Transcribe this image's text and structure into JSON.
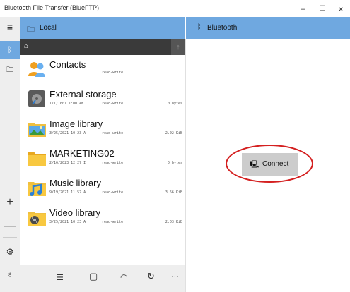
{
  "window": {
    "title": "Bluetooth File Transfer (BlueFTP)",
    "minimize_glyph": "–",
    "maximize_glyph": "☐",
    "close_glyph": "×"
  },
  "sidebar": {
    "menu_glyph": "≡",
    "bluetooth_glyph": "ᛒ",
    "local_glyph": "🗀",
    "plus_glyph": "+",
    "minus_glyph": "—",
    "settings_glyph": "⚙",
    "tips_glyph": "♁"
  },
  "left_pane": {
    "title": "Local",
    "icon_glyph": "🗀",
    "home_glyph": "⌂",
    "up_glyph": "↑",
    "items": [
      {
        "name": "Contacts",
        "date": "",
        "permission": "read-write",
        "size": "",
        "icon": "contacts-icon"
      },
      {
        "name": "External storage",
        "date": "1/1/1601 1:00 AM",
        "permission": "read-write",
        "size": "0 bytes",
        "icon": "external-storage-icon"
      },
      {
        "name": "Image library",
        "date": "3/25/2021 10:23 A",
        "permission": "read-write",
        "size": "2.02 KiB",
        "icon": "image-library-icon"
      },
      {
        "name": "MARKETING02",
        "date": "2/16/2023 12:27 I",
        "permission": "read-write",
        "size": "0 bytes",
        "icon": "folder-icon"
      },
      {
        "name": "Music library",
        "date": "9/19/2021 11:57 A",
        "permission": "read-write",
        "size": "3.56 KiB",
        "icon": "music-library-icon"
      },
      {
        "name": "Video library",
        "date": "3/25/2021 10:23 A",
        "permission": "read-write",
        "size": "2.03 KiB",
        "icon": "video-library-icon"
      }
    ]
  },
  "right_pane": {
    "title": "Bluetooth",
    "icon_glyph": "ᛒ",
    "connect_label": "Connect",
    "connect_glyph": "🖳"
  },
  "bottom_bar": {
    "select_glyph": "☰",
    "device_glyph": "▢",
    "sync_glyph": "◠",
    "refresh_glyph": "↻",
    "more_glyph": "···"
  },
  "colors": {
    "header_blue": "#6fa8e0",
    "path_bar": "#3a3a3a",
    "highlight_ring": "#d42020",
    "connect_button": "#cccccc"
  }
}
